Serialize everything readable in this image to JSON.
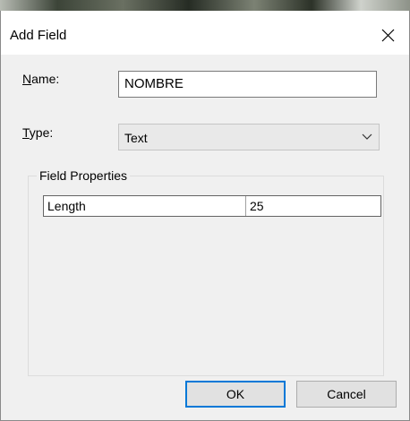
{
  "dialog": {
    "title": "Add Field",
    "close_icon": "close-icon"
  },
  "form": {
    "name": {
      "label_access_key": "N",
      "label_rest": "ame:",
      "value": "NOMBRE"
    },
    "type": {
      "label_access_key": "T",
      "label_rest": "ype:",
      "selected": "Text",
      "chevron_icon": "chevron-down-icon"
    }
  },
  "field_properties": {
    "title": "Field Properties",
    "rows": [
      {
        "name": "Length",
        "value": "25"
      }
    ]
  },
  "buttons": {
    "ok": "OK",
    "cancel": "Cancel"
  },
  "colors": {
    "focus_accent": "#0078d7",
    "dialog_bg": "#f0f0f0",
    "titlebar_bg": "#ffffff"
  }
}
